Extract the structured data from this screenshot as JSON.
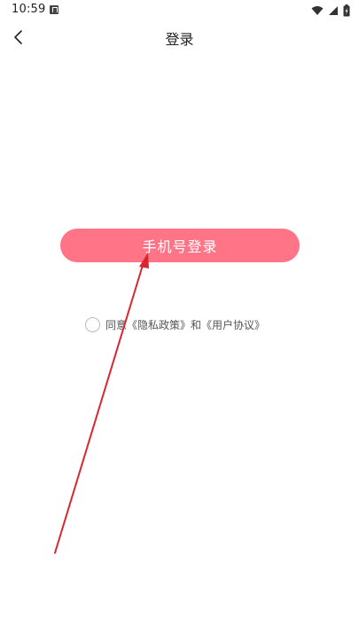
{
  "status_bar": {
    "time": "10:59"
  },
  "app_bar": {
    "title": "登录"
  },
  "login": {
    "phone_login_label": "手机号登录"
  },
  "agreement": {
    "prefix": "同意",
    "privacy_link": "《隐私政策》",
    "conjunction": "和",
    "user_agreement_link": "《用户协议》",
    "checked": false
  },
  "colors": {
    "accent": "#ff7587",
    "annotation_arrow": "#d9262f"
  }
}
